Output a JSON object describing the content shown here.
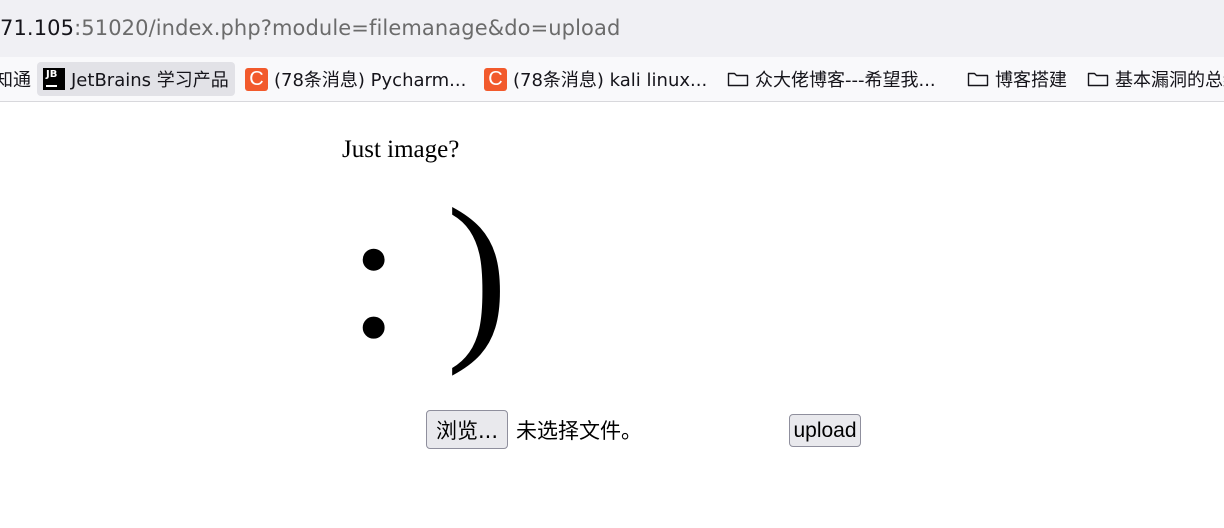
{
  "browser": {
    "url_host": "71.105",
    "url_rest": ":51020/index.php?module=filemanage&do=upload",
    "bookmarks": [
      {
        "label": "知通",
        "icon": "none"
      },
      {
        "label": "JetBrains 学习产品",
        "icon": "jetbrains-icon"
      },
      {
        "label": "(78条消息) Pycharm...",
        "icon": "csdn-icon"
      },
      {
        "label": "(78条消息) kali linux...",
        "icon": "csdn-icon"
      },
      {
        "label": "众大佬博客---希望我...",
        "icon": "folder-icon"
      },
      {
        "label": "博客搭建",
        "icon": "folder-icon"
      },
      {
        "label": "基本漏洞的总结",
        "icon": "folder-icon"
      }
    ],
    "jb_letters": "JB",
    "csdn_letter": "C"
  },
  "page": {
    "heading": "Just image?",
    "smiley": ": )",
    "browse_label": "浏览...",
    "file_status": "未选择文件。",
    "upload_label": "upload"
  },
  "colors": {
    "urlbar_bg": "#f0f0f4",
    "csdn_brand": "#f25a2c",
    "jetbrains_brand": "#000000"
  }
}
